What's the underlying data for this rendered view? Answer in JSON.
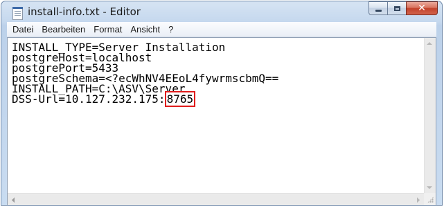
{
  "window": {
    "title": "install-info.txt - Editor"
  },
  "menubar": {
    "items": [
      {
        "label": "Datei"
      },
      {
        "label": "Bearbeiten"
      },
      {
        "label": "Format"
      },
      {
        "label": "Ansicht"
      },
      {
        "label": "?"
      }
    ]
  },
  "editor": {
    "lines": [
      "INSTALL_TYPE=Server Installation",
      "postgreHost=localhost",
      "postgrePort=5433",
      "postgreSchema=<?ecWhNV4EEoL4fywrmscbmQ==",
      "INSTALL_PATH=C:\\ASV\\Server",
      "DSS-Url=10.127.232.175:"
    ],
    "highlighted_port": "8765"
  },
  "colors": {
    "highlight_border": "#e01c1c",
    "close_button": "#c2412a"
  },
  "icons": {
    "app": "notepad-document-icon",
    "minimize": "minimize-icon",
    "maximize": "maximize-icon",
    "close": "close-icon"
  }
}
